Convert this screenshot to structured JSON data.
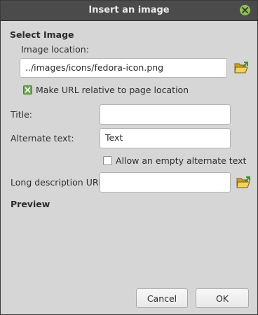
{
  "window": {
    "title": "Insert an image"
  },
  "select_image": {
    "heading": "Select Image",
    "location_label": "Image location:",
    "location_value": "../images/icons/fedora-icon.png",
    "relative_label": "Make URL relative to page location",
    "relative_checked": true
  },
  "fields": {
    "title_label": "Title:",
    "title_value": "",
    "alt_label": "Alternate text:",
    "alt_value": "Text",
    "empty_alt_label": "Allow an empty alternate text",
    "empty_alt_checked": false,
    "longdesc_label": "Long description URI:",
    "longdesc_value": ""
  },
  "preview": {
    "heading": "Preview"
  },
  "buttons": {
    "cancel": "Cancel",
    "ok": "OK"
  },
  "colors": {
    "titlebar": "#4b4b4b",
    "dialog_bg": "#d6d6d6",
    "accent_green": "#8fbf5a"
  }
}
